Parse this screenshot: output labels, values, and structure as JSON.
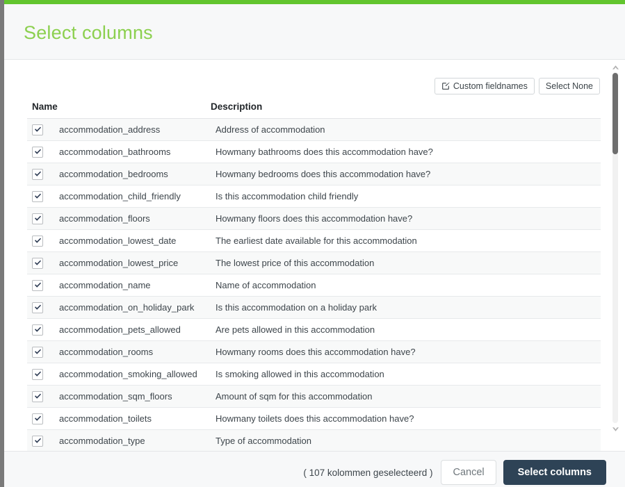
{
  "theme": {
    "accent_green": "#62c52e",
    "title_green": "#8cd04f",
    "primary_button": "#2e4356",
    "row_alt": "#f8f9f9",
    "header_bg": "#f7f8f9"
  },
  "header": {
    "title": "Select columns"
  },
  "toolbar": {
    "custom_fieldnames_label": "Custom fieldnames",
    "custom_fieldnames_icon": "pencil-square-icon",
    "select_none_label": "Select None"
  },
  "table": {
    "columns": [
      "Name",
      "Description"
    ],
    "rows": [
      {
        "checked": true,
        "name": "accommodation_address",
        "description": "Address of accommodation"
      },
      {
        "checked": true,
        "name": "accommodation_bathrooms",
        "description": "Howmany bathrooms does this accommodation have?"
      },
      {
        "checked": true,
        "name": "accommodation_bedrooms",
        "description": "Howmany bedrooms does this accommodation have?"
      },
      {
        "checked": true,
        "name": "accommodation_child_friendly",
        "description": "Is this accommodation child friendly"
      },
      {
        "checked": true,
        "name": "accommodation_floors",
        "description": "Howmany floors does this accommodation have?"
      },
      {
        "checked": true,
        "name": "accommodation_lowest_date",
        "description": "The earliest date available for this accommodation"
      },
      {
        "checked": true,
        "name": "accommodation_lowest_price",
        "description": "The lowest price of this accommodation"
      },
      {
        "checked": true,
        "name": "accommodation_name",
        "description": "Name of accommodation"
      },
      {
        "checked": true,
        "name": "accommodation_on_holiday_park",
        "description": "Is this accommodation on a holiday park"
      },
      {
        "checked": true,
        "name": "accommodation_pets_allowed",
        "description": "Are pets allowed in this accommodation"
      },
      {
        "checked": true,
        "name": "accommodation_rooms",
        "description": "Howmany rooms does this accommodation have?"
      },
      {
        "checked": true,
        "name": "accommodation_smoking_allowed",
        "description": "Is smoking allowed in this accommodation"
      },
      {
        "checked": true,
        "name": "accommodation_sqm_floors",
        "description": "Amount of sqm for this accommodation"
      },
      {
        "checked": true,
        "name": "accommodation_toilets",
        "description": "Howmany toilets does this accommodation have?"
      },
      {
        "checked": true,
        "name": "accommodation_type",
        "description": "Type of accommodation"
      }
    ]
  },
  "scrollbar": {
    "up_icon": "chevron-up-icon",
    "down_icon": "chevron-down-icon"
  },
  "footer": {
    "selection_count_text": "( 107 kolommen geselecteerd )",
    "cancel_label": "Cancel",
    "submit_label": "Select columns"
  }
}
